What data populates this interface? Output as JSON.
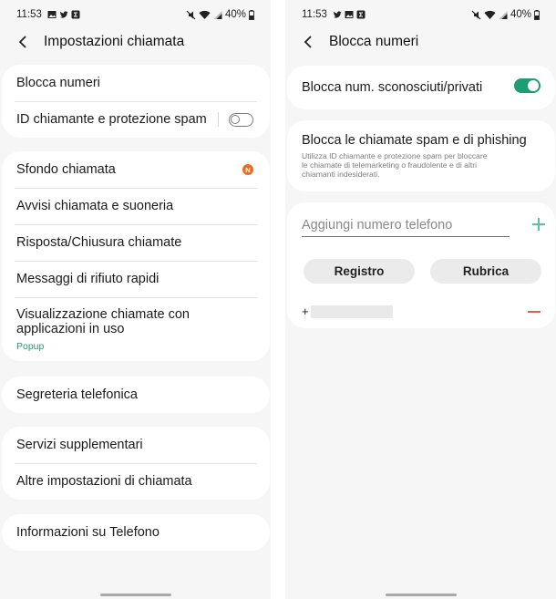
{
  "left": {
    "status": {
      "time": "11:53",
      "battery": "40%"
    },
    "header": {
      "title": "Impostazioni chiamata"
    },
    "group1": [
      {
        "label": "Blocca numeri"
      },
      {
        "label": "ID chiamante e protezione spam"
      }
    ],
    "group2": [
      {
        "label": "Sfondo chiamata",
        "badge": "N"
      },
      {
        "label": "Avvisi chiamata e suoneria"
      },
      {
        "label": "Risposta/Chiusura chiamate"
      },
      {
        "label": "Messaggi di rifiuto rapidi"
      },
      {
        "label_line1": "Visualizzazione chiamate con",
        "label_line2": "applicazioni in uso",
        "sub": "Popup"
      }
    ],
    "group3": [
      {
        "label": "Segreteria telefonica"
      }
    ],
    "group4": [
      {
        "label": "Servizi supplementari"
      },
      {
        "label": "Altre impostazioni di chiamata"
      }
    ],
    "group5": [
      {
        "label": "Informazioni su Telefono"
      }
    ]
  },
  "right": {
    "status": {
      "time": "11:53",
      "battery": "40%"
    },
    "header": {
      "title": "Blocca numeri"
    },
    "unknown": {
      "label": "Blocca num. sconosciuti/privati",
      "enabled": true
    },
    "spam": {
      "title": "Blocca le chiamate spam e di phishing",
      "desc_lines": [
        "Utilizza ID chiamante e protezione spam per bloccare",
        "le chiamate di telemarketing o fraudolente e di altri",
        "chiamanti indesiderati."
      ]
    },
    "add": {
      "placeholder": "Aggiungi numero telefono"
    },
    "buttons": {
      "log": "Registro",
      "contacts": "Rubrica"
    },
    "blocked": {
      "prefix": "+"
    }
  },
  "colors": {
    "accent": "#1e9c72",
    "badge": "#ef6b1e",
    "remove": "#e0623a"
  }
}
